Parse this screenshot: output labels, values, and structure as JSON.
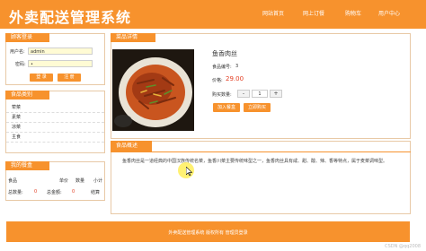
{
  "header": {
    "site_title": "外卖配送管理系统",
    "nav": [
      "网站首页",
      "网上订餐",
      "购物车",
      "用户中心"
    ]
  },
  "login": {
    "title": "顾客登录",
    "username_label": "用户名:",
    "username_value": "admin",
    "password_label": "密码:",
    "password_value": "•",
    "login_button": "登 录",
    "register_button": "注 册"
  },
  "categories": {
    "title": "食品类别",
    "items": [
      "荤菜",
      "素菜",
      "凉菜",
      "主食"
    ]
  },
  "cart": {
    "title": "我的餐盒",
    "headers": [
      "食品",
      "单价",
      "数量",
      "小计"
    ],
    "total_qty_label": "总数量:",
    "total_qty_value": "0",
    "total_price_label": "总金额:",
    "total_price_value": "0",
    "checkout": "结算"
  },
  "detail": {
    "title": "菜品详情",
    "name": "鱼香肉丝",
    "code_label": "食品编号:",
    "code_value": "3",
    "price_label": "价格:",
    "price_value": "29.00",
    "qty_label": "购买数量:",
    "qty_minus": "-",
    "qty_value": "1",
    "qty_plus": "+",
    "add_cart": "加入餐盒",
    "buy_now": "立即购买"
  },
  "description": {
    "title": "食品概述",
    "text": "鱼香肉丝是一道经典的中国汉族传统名菜，鱼香川菜主要传统味型之一，鱼香肉丝具有咸、甜、酸、辣、香等特点，属于麦菜调味型。"
  },
  "footer": {
    "text": "外卖配送管理系统  版权所有  管理员登录"
  },
  "watermark": "CSDN @qq2008",
  "colors": {
    "accent": "#f7922d",
    "price": "#e23b1f"
  }
}
